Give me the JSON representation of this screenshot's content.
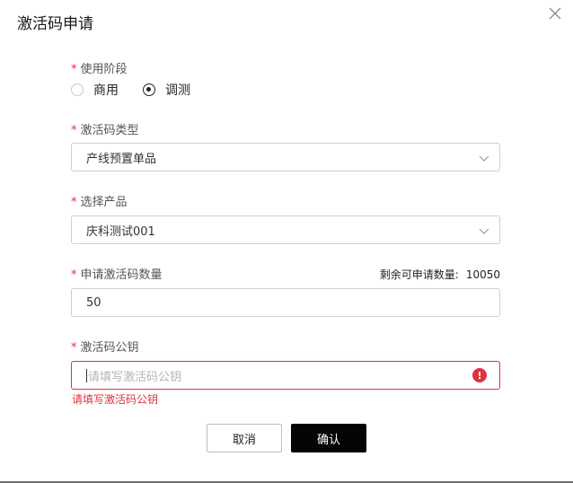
{
  "dialog": {
    "title": "激活码申请",
    "required_mark": "*"
  },
  "fields": {
    "stage": {
      "label": "使用阶段",
      "options": [
        {
          "label": "商用",
          "checked": false
        },
        {
          "label": "调测",
          "checked": true
        }
      ]
    },
    "code_type": {
      "label": "激活码类型",
      "value": "产线预置单品"
    },
    "product": {
      "label": "选择产品",
      "value": "庆科测试001"
    },
    "quantity": {
      "label": "申请激活码数量",
      "remaining_label": "剩余可申请数量:",
      "remaining_value": "10050",
      "value": "50"
    },
    "public_key": {
      "label": "激活码公钥",
      "placeholder": "请填写激活码公钥",
      "error": "请填写激活码公钥",
      "error_icon": "!"
    }
  },
  "buttons": {
    "cancel": "取消",
    "confirm": "确认"
  },
  "colors": {
    "required": "#e0313e",
    "error": "#e0313e",
    "primary_button": "#050505"
  },
  "icons": {
    "close": "close-icon",
    "select_arrow": "chevron-down-icon",
    "error": "error-icon"
  }
}
